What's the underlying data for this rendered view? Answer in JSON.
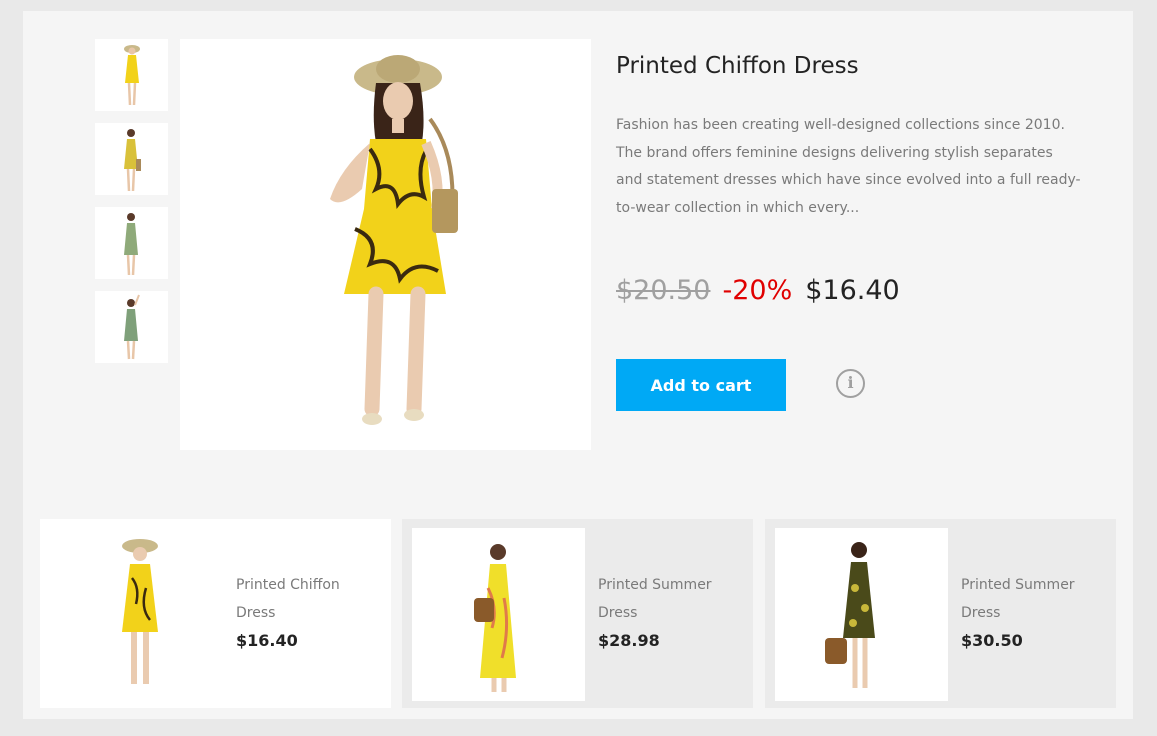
{
  "product": {
    "title": "Printed Chiffon Dress",
    "description": "Fashion has been creating well-designed collections since 2010. The brand offers feminine designs delivering stylish separates and statement dresses which have since evolved into a full ready-to-wear collection in which every...",
    "old_price": "$20.50",
    "discount": "-20%",
    "price": "$16.40",
    "add_to_cart_label": "Add to cart",
    "info_icon": "info-icon",
    "thumbnails": [
      {
        "dress_color": "#f2d21a",
        "pose": "hat"
      },
      {
        "dress_color": "#d9c13a",
        "pose": "standing"
      },
      {
        "dress_color": "#8faa7a",
        "pose": "standing"
      },
      {
        "dress_color": "#7fa07a",
        "pose": "arm-up"
      }
    ]
  },
  "related": [
    {
      "name": "Printed Chiffon Dress",
      "price": "$16.40",
      "dress_color": "#f2d21a",
      "active": true
    },
    {
      "name": "Printed Summer Dress",
      "price": "$28.98",
      "dress_color": "#f0df2a",
      "active": false
    },
    {
      "name": "Printed Summer Dress",
      "price": "$30.50",
      "dress_color": "#4a4a1a",
      "active": false
    }
  ],
  "colors": {
    "accent": "#00a9f5",
    "discount": "#e00000",
    "text_dark": "#232323",
    "text_muted": "#7a7a7a"
  }
}
